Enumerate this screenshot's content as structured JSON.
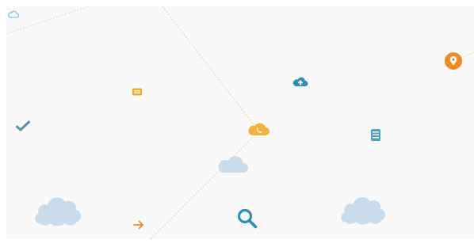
{
  "scene": {
    "background": "#ffffff",
    "panel_color": "#f9f9f9",
    "line_color": "#f6d9b8"
  },
  "icons": [
    {
      "name": "cloud-outline-icon",
      "color": "#7fc3dc"
    },
    {
      "name": "card-icon",
      "color": "#f5a623"
    },
    {
      "name": "checkmark-icon",
      "color": "#5b8fa8"
    },
    {
      "name": "cloud-upload-icon",
      "color": "#2d8fb8"
    },
    {
      "name": "cloud-phone-icon",
      "color": "#f5b13a"
    },
    {
      "name": "database-icon",
      "color": "#4aa3c7"
    },
    {
      "name": "location-pin-icon",
      "color": "#f08a24"
    },
    {
      "name": "search-icon",
      "color": "#2d8fb8"
    },
    {
      "name": "arrow-right-icon",
      "color": "#f08a24"
    },
    {
      "name": "cloud-large-icon",
      "color": "#c9dcec"
    }
  ]
}
